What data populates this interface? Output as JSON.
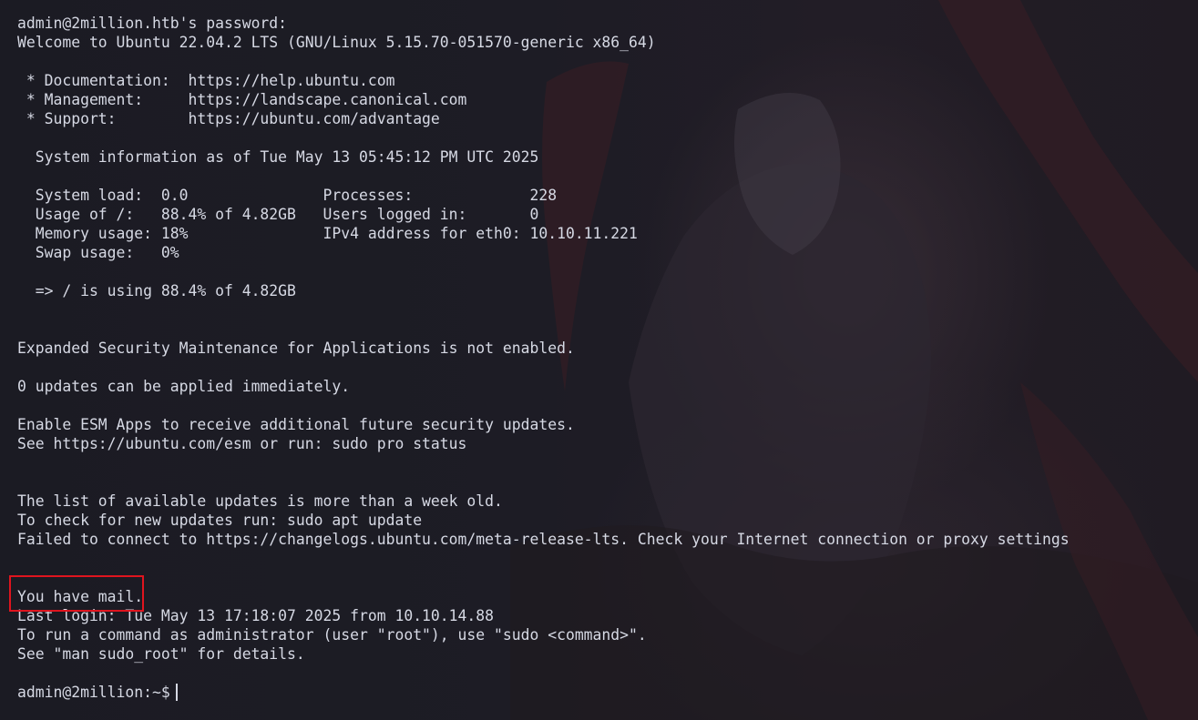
{
  "terminal": {
    "lines": [
      "admin@2million.htb's password:",
      "Welcome to Ubuntu 22.04.2 LTS (GNU/Linux 5.15.70-051570-generic x86_64)",
      "",
      " * Documentation:  https://help.ubuntu.com",
      " * Management:     https://landscape.canonical.com",
      " * Support:        https://ubuntu.com/advantage",
      "",
      "  System information as of Tue May 13 05:45:12 PM UTC 2025",
      "",
      "  System load:  0.0               Processes:             228",
      "  Usage of /:   88.4% of 4.82GB   Users logged in:       0",
      "  Memory usage: 18%               IPv4 address for eth0: 10.10.11.221",
      "  Swap usage:   0%",
      "",
      "  => / is using 88.4% of 4.82GB",
      "",
      "",
      "Expanded Security Maintenance for Applications is not enabled.",
      "",
      "0 updates can be applied immediately.",
      "",
      "Enable ESM Apps to receive additional future security updates.",
      "See https://ubuntu.com/esm or run: sudo pro status",
      "",
      "",
      "The list of available updates is more than a week old.",
      "To check for new updates run: sudo apt update",
      "Failed to connect to https://changelogs.ubuntu.com/meta-release-lts. Check your Internet connection or proxy settings",
      "",
      "",
      "You have mail.",
      "Last login: Tue May 13 17:18:07 2025 from 10.10.14.88",
      "To run a command as administrator (user \"root\"), use \"sudo <command>\".",
      "See \"man sudo_root\" for details.",
      "",
      "admin@2million:~$"
    ]
  },
  "colors": {
    "background": "#1c1c24",
    "text": "#d6d9e4",
    "highlight_border": "#e0141e"
  }
}
